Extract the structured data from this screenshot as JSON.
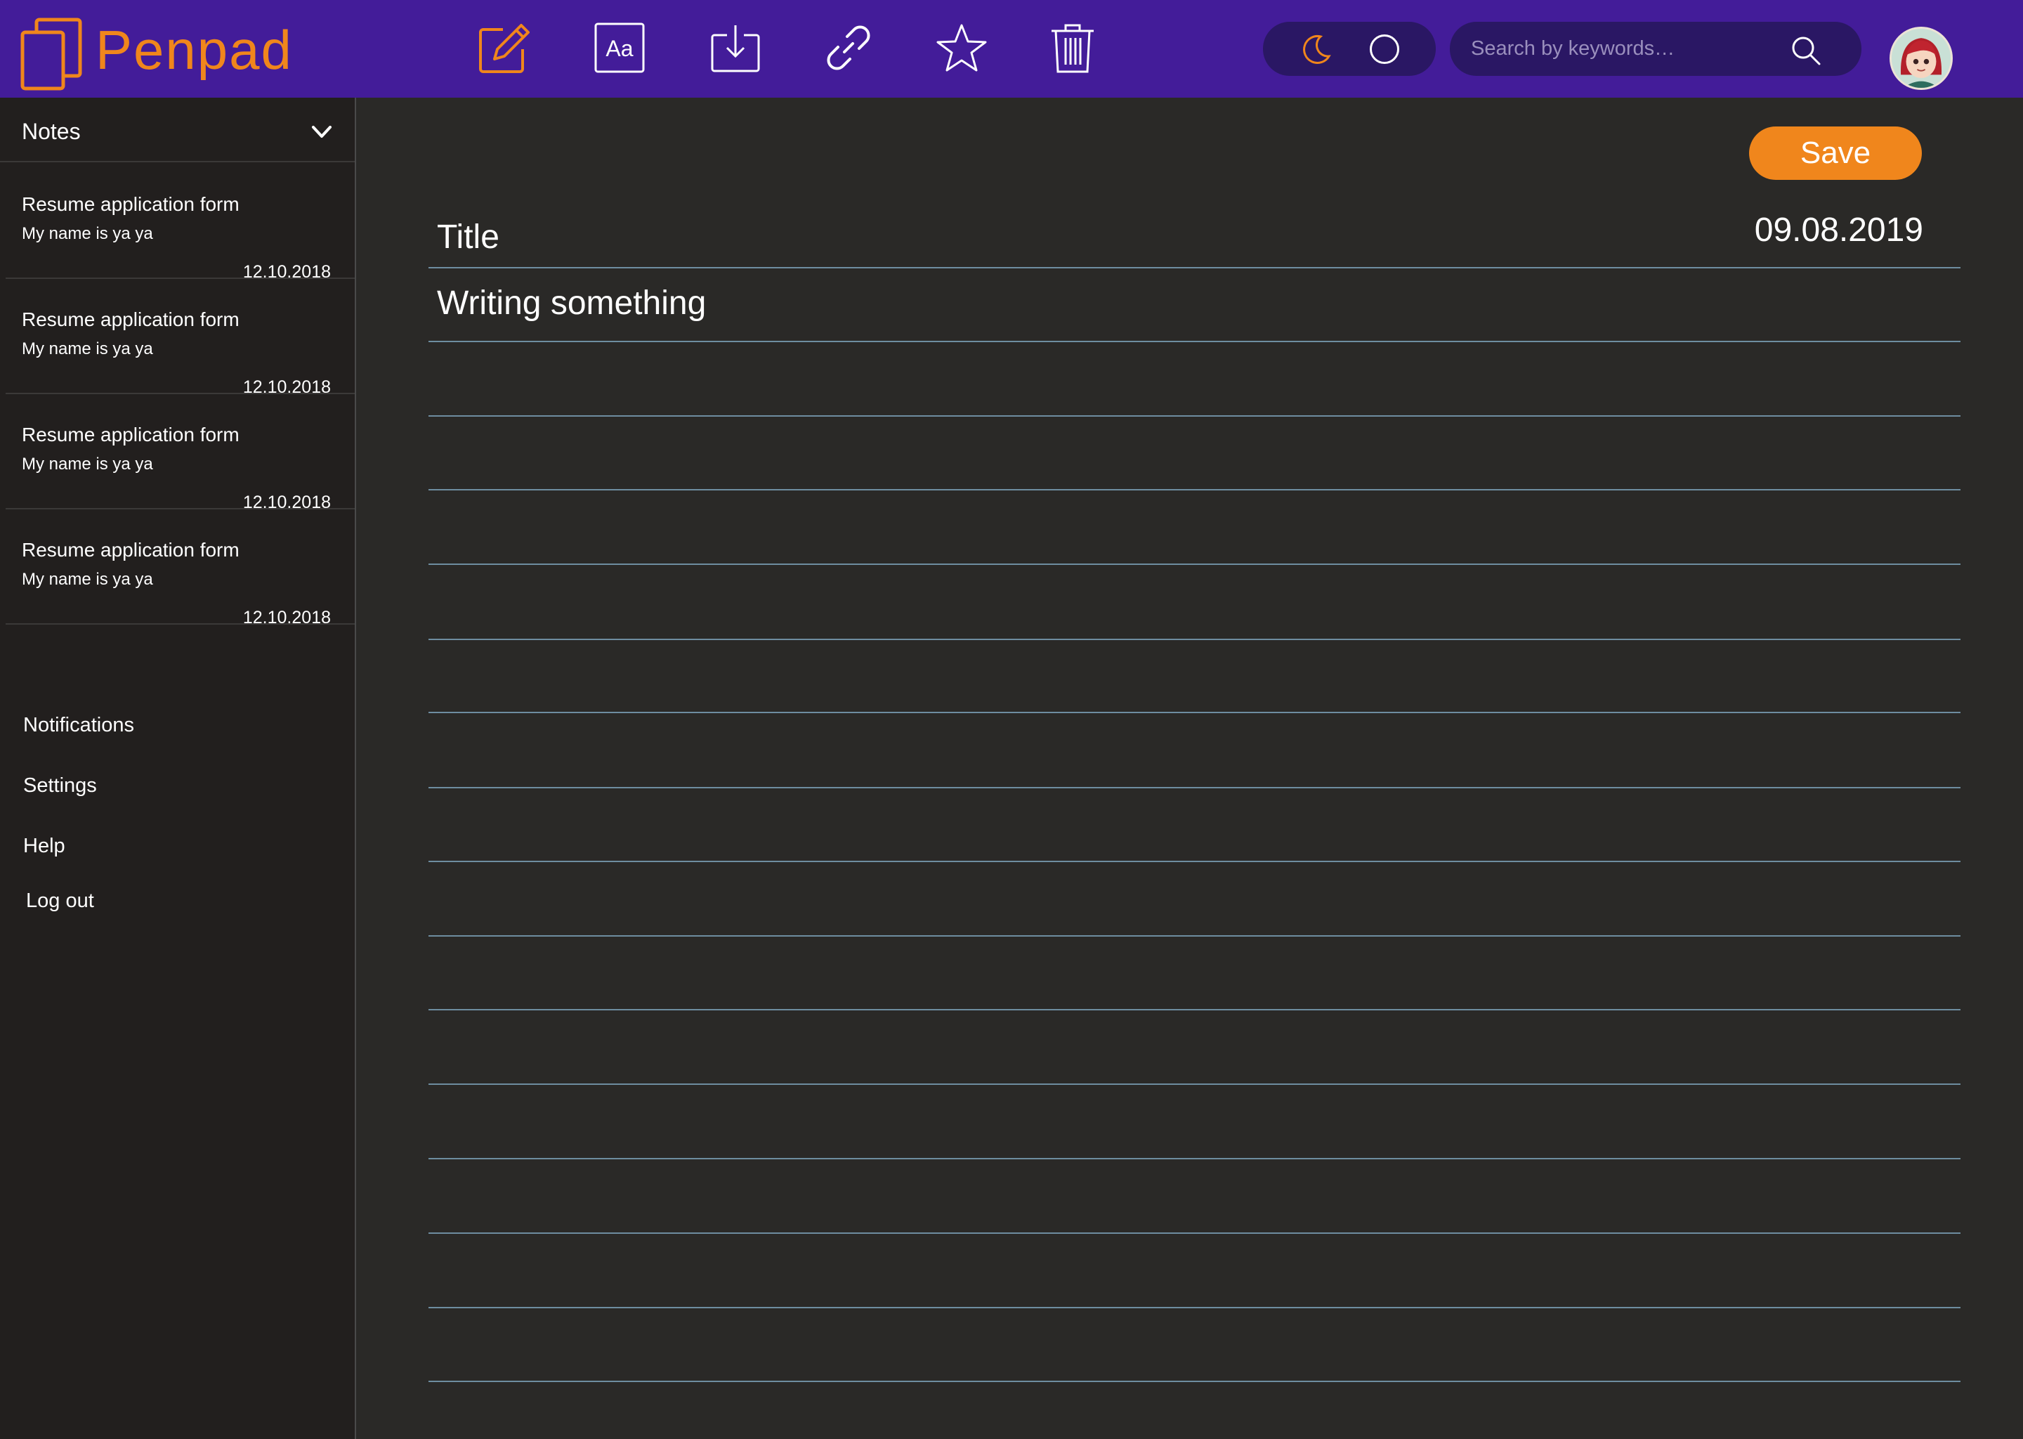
{
  "app": {
    "name": "Penpad",
    "brand_color": "#f0861c",
    "topbar_color": "#431c99"
  },
  "toolbar": {
    "items": [
      {
        "name": "edit",
        "icon": "pencil-edit-icon",
        "active": true
      },
      {
        "name": "font",
        "icon": "font-format-icon",
        "glyph": "Aa"
      },
      {
        "name": "download",
        "icon": "download-icon"
      },
      {
        "name": "link",
        "icon": "link-icon"
      },
      {
        "name": "favorite",
        "icon": "star-icon"
      },
      {
        "name": "delete",
        "icon": "trash-icon"
      }
    ]
  },
  "theme": {
    "dark_icon": "moon-icon",
    "light_icon": "circle-icon"
  },
  "search": {
    "placeholder": "Search by keywords…",
    "value": ""
  },
  "sidebar": {
    "header": "Notes",
    "notes": [
      {
        "title": "Resume application form",
        "preview": "My name is ya ya",
        "date": "12.10.2018"
      },
      {
        "title": "Resume application form",
        "preview": "My name is ya ya",
        "date": "12.10.2018"
      },
      {
        "title": "Resume application form",
        "preview": "My name is ya ya",
        "date": "12.10.2018"
      },
      {
        "title": "Resume application form",
        "preview": "My name is ya ya",
        "date": "12.10.2018"
      }
    ],
    "menu": [
      "Notifications",
      "Settings",
      "Help",
      "Log out"
    ]
  },
  "editor": {
    "save_label": "Save",
    "date": "09.08.2019",
    "title": "Title",
    "body": "Writing something"
  }
}
